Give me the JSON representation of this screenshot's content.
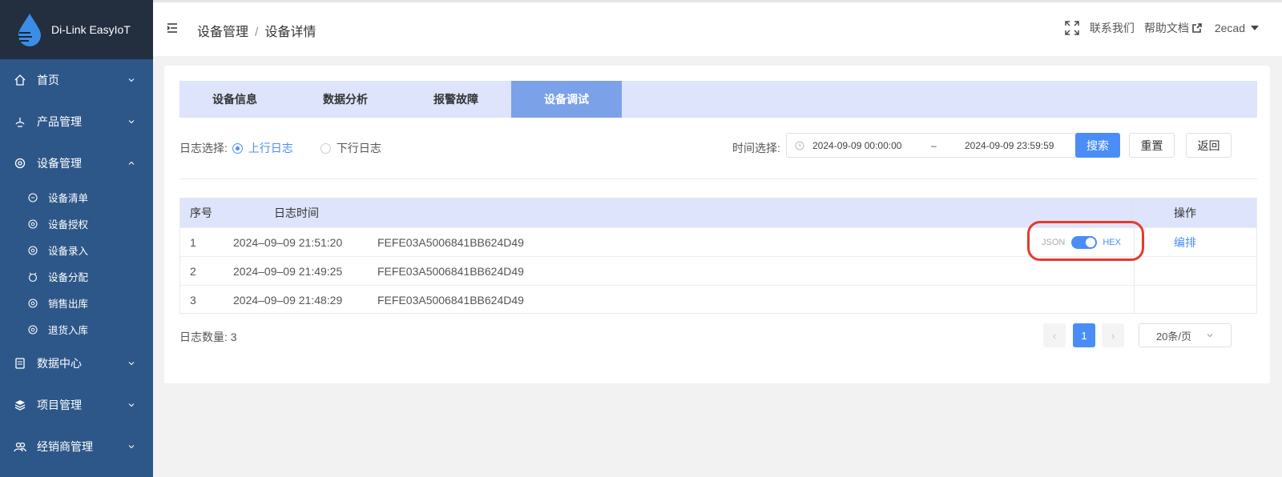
{
  "brand": {
    "name": "Di-Link EasyIoT"
  },
  "sidebar": {
    "items": [
      {
        "label": "首页"
      },
      {
        "label": "产品管理"
      },
      {
        "label": "设备管理"
      },
      {
        "label": "数据中心"
      },
      {
        "label": "项目管理"
      },
      {
        "label": "经销商管理"
      }
    ],
    "sub_items": [
      {
        "label": "设备清单"
      },
      {
        "label": "设备授权"
      },
      {
        "label": "设备录入"
      },
      {
        "label": "设备分配"
      },
      {
        "label": "销售出库"
      },
      {
        "label": "退货入库"
      }
    ]
  },
  "header": {
    "breadcrumb": [
      "设备管理",
      "设备详情"
    ],
    "separator": "/",
    "contact": "联系我们",
    "help": "帮助文档",
    "user": "2ecad"
  },
  "tabs": [
    "设备信息",
    "数据分析",
    "报警故障",
    "设备调试"
  ],
  "filter": {
    "log_label": "日志选择:",
    "up_log": "上行日志",
    "down_log": "下行日志",
    "time_label": "时间选择:",
    "start": "2024-09-09 00:00:00",
    "range_sep": "–",
    "end": "2024-09-09 23:59:59",
    "search": "搜索",
    "reset": "重置",
    "back": "返回"
  },
  "table": {
    "headers": {
      "no": "序号",
      "time": "日志时间",
      "op": "操作"
    },
    "rows": [
      {
        "no": "1",
        "time": "2024–09–09 21:51:20",
        "data": "FEFE03A5006841BB624D49"
      },
      {
        "no": "2",
        "time": "2024–09–09 21:49:25",
        "data": "FEFE03A5006841BB624D49"
      },
      {
        "no": "3",
        "time": "2024–09–09 21:48:29",
        "data": "FEFE03A5006841BB624D49"
      }
    ],
    "toggle": {
      "left": "JSON",
      "right": "HEX"
    },
    "op_link": "编排"
  },
  "footer": {
    "count": "日志数量: 3",
    "prev": "‹",
    "page": "1",
    "next": "›",
    "page_size": "20条/页"
  },
  "colors": {
    "sidebar": "#2e5789",
    "brand_bg": "#232e3f",
    "accent": "#4a8df7",
    "tab_bg": "#dde4fb",
    "tab_active": "#7ba1e8",
    "highlight": "#e8392d"
  }
}
